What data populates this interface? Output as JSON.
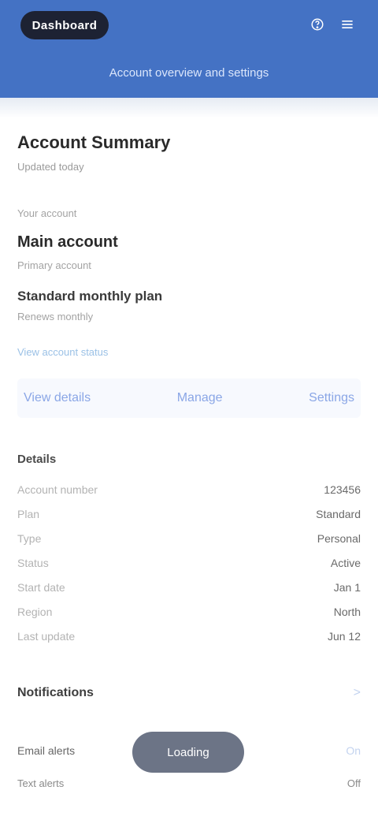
{
  "header": {
    "logo_text": "Dashboard",
    "actions": [
      "Help",
      "Menu"
    ],
    "subtitle": "Account overview and settings"
  },
  "summary": {
    "title": "Account Summary",
    "meta": "Updated today",
    "kicker": "Your account",
    "account_name": "Main account",
    "account_desc": "Primary account",
    "plan_title": "Standard monthly plan",
    "plan_sub": "Renews monthly",
    "status_link": "View account status"
  },
  "links": {
    "left": "View details",
    "middle": "Manage",
    "right": "Settings"
  },
  "details": {
    "heading": "Details",
    "count": "",
    "rows": [
      {
        "label": "Account number",
        "value": "123456"
      },
      {
        "label": "Plan",
        "value": "Standard"
      },
      {
        "label": "Type",
        "value": "Personal"
      },
      {
        "label": "Status",
        "value": "Active"
      },
      {
        "label": "Start date",
        "value": "Jan 1"
      },
      {
        "label": "Region",
        "value": "North"
      },
      {
        "label": "Last update",
        "value": "Jun 12"
      }
    ]
  },
  "notes": {
    "heading": "Notifications",
    "more": ">",
    "row1_left": "Email alerts",
    "row1_right": "On",
    "row2_left": "Text alerts",
    "row2_right": "Off"
  },
  "toast": {
    "label": "Loading"
  }
}
